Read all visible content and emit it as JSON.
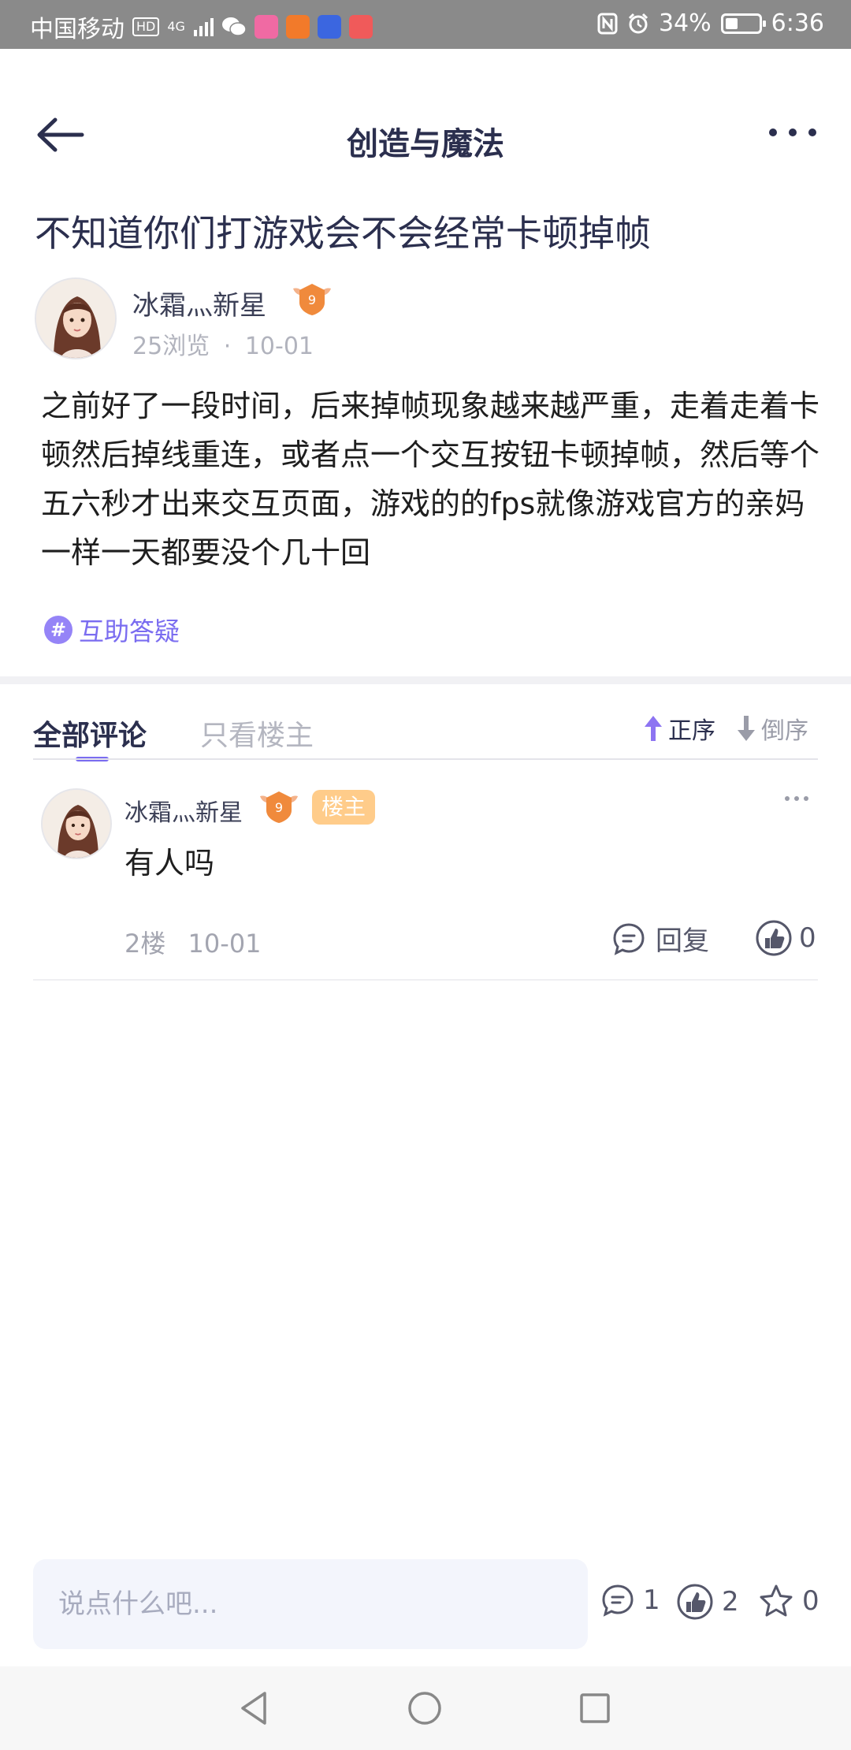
{
  "status_bar": {
    "carrier": "中国移动",
    "hd": "HD",
    "network": "4G",
    "battery_percent": "34%",
    "battery_level": 0.34,
    "time": "6:36",
    "icons": [
      "wechat-icon",
      "bilibili-icon",
      "taobao-icon",
      "tieba-icon",
      "mail-icon",
      "nfc-icon",
      "alarm-icon",
      "battery-icon"
    ]
  },
  "header": {
    "title": "创造与魔法",
    "back_icon": "arrow-left-icon",
    "more_icon": "more-horizontal-icon"
  },
  "post": {
    "title": "不知道你们打游戏会不会经常卡顿掉帧",
    "author": {
      "name": "冰霜灬新星",
      "level": "9",
      "views": "25浏览",
      "separator": "·",
      "date": "10-01"
    },
    "body": "之前好了一段时间，后来掉帧现象越来越严重，走着走着卡顿然后掉线重连，或者点一个交互按钮卡顿掉帧，然后等个五六秒才出来交互页面，游戏的的fps就像游戏官方的亲妈一样一天都要没个几十回",
    "topic_hash": "#",
    "topic": "互助答疑"
  },
  "comments_header": {
    "tab_all": "全部评论",
    "tab_op_only": "只看楼主",
    "sort_asc": "正序",
    "sort_desc": "倒序"
  },
  "comments": [
    {
      "name": "冰霜灬新星",
      "level": "9",
      "op_badge": "楼主",
      "text": "有人吗",
      "floor": "2楼",
      "date": "10-01",
      "reply_label": "回复",
      "likes": "0"
    }
  ],
  "bottom_bar": {
    "input_placeholder": "说点什么吧...",
    "comment_count": "1",
    "like_count": "2",
    "favorite_count": "0"
  },
  "colors": {
    "accent": "#7a6cf0",
    "title_text": "#2b2f4e",
    "op_badge_bg": "#ffcc8a",
    "level_badge": "#f08a3c"
  }
}
